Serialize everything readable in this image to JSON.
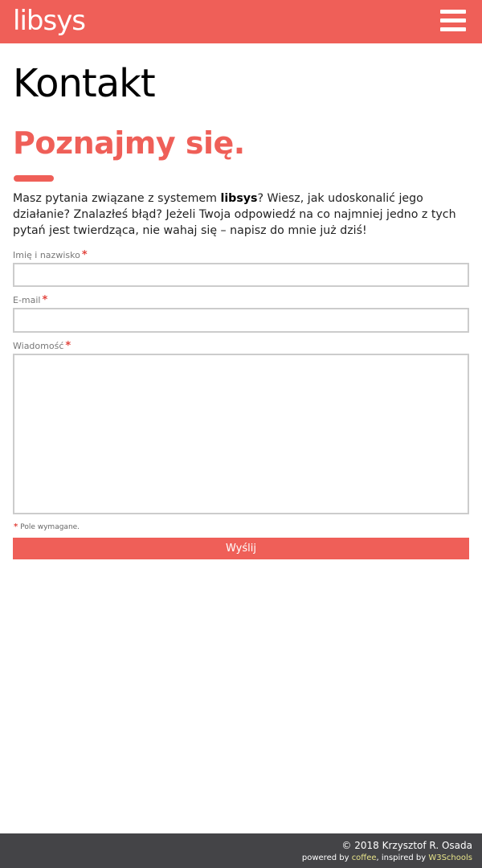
{
  "header": {
    "logo": "libsys",
    "menu_icon": "hamburger-menu-icon"
  },
  "main": {
    "title": "Kontakt",
    "subtitle": "Poznajmy się.",
    "intro": {
      "part1": "Masz pytania związane z systemem ",
      "brand": "libsys",
      "part2": "? Wiesz, jak udoskonalić jego działanie? Znalazłeś błąd? Jeżeli Twoja odpowiedź na co najmniej jedno z tych pytań jest twierdząca, nie wahaj się – napisz do mnie już dziś!"
    }
  },
  "form": {
    "name_label": "Imię i nazwisko",
    "email_label": "E-mail",
    "message_label": "Wiadomość",
    "required_mark": "*",
    "required_note": "Pole wymagane.",
    "submit_label": "Wyślij",
    "name_value": "",
    "email_value": "",
    "message_value": ""
  },
  "footer": {
    "copyright": "© 2018 Krzysztof R. Osada",
    "powered_prefix": "powered by ",
    "powered_link": "coffee",
    "inspired_prefix": ", inspired by ",
    "inspired_link": "W3Schools"
  },
  "colors": {
    "accent": "#ef5f58",
    "footer_bg": "#444447",
    "footer_link": "#e8e48a"
  }
}
